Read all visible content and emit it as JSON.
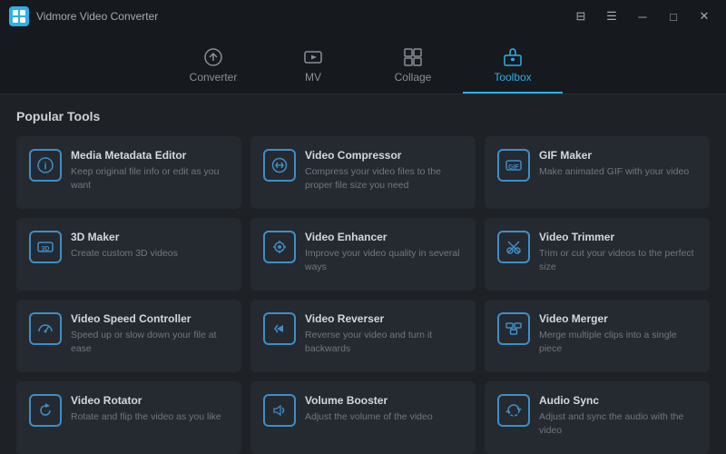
{
  "app": {
    "title": "Vidmore Video Converter"
  },
  "titlebar": {
    "controls": {
      "menu": "☰",
      "minimize": "─",
      "maximize": "□",
      "close": "✕",
      "subtitle": "⊟"
    }
  },
  "nav": {
    "tabs": [
      {
        "id": "converter",
        "label": "Converter",
        "active": false
      },
      {
        "id": "mv",
        "label": "MV",
        "active": false
      },
      {
        "id": "collage",
        "label": "Collage",
        "active": false
      },
      {
        "id": "toolbox",
        "label": "Toolbox",
        "active": true
      }
    ]
  },
  "main": {
    "section_title": "Popular Tools",
    "tools": [
      {
        "id": "media-metadata-editor",
        "name": "Media Metadata Editor",
        "desc": "Keep original file info or edit as you want",
        "icon_type": "info"
      },
      {
        "id": "video-compressor",
        "name": "Video Compressor",
        "desc": "Compress your video files to the proper file size you need",
        "icon_type": "compress"
      },
      {
        "id": "gif-maker",
        "name": "GIF Maker",
        "desc": "Make animated GIF with your video",
        "icon_type": "gif"
      },
      {
        "id": "3d-maker",
        "name": "3D Maker",
        "desc": "Create custom 3D videos",
        "icon_type": "3d"
      },
      {
        "id": "video-enhancer",
        "name": "Video Enhancer",
        "desc": "Improve your video quality in several ways",
        "icon_type": "enhancer"
      },
      {
        "id": "video-trimmer",
        "name": "Video Trimmer",
        "desc": "Trim or cut your videos to the perfect size",
        "icon_type": "trim"
      },
      {
        "id": "video-speed-controller",
        "name": "Video Speed Controller",
        "desc": "Speed up or slow down your file at ease",
        "icon_type": "speed"
      },
      {
        "id": "video-reverser",
        "name": "Video Reverser",
        "desc": "Reverse your video and turn it backwards",
        "icon_type": "reverse"
      },
      {
        "id": "video-merger",
        "name": "Video Merger",
        "desc": "Merge multiple clips into a single piece",
        "icon_type": "merge"
      },
      {
        "id": "video-rotator",
        "name": "Video Rotator",
        "desc": "Rotate and flip the video as you like",
        "icon_type": "rotate"
      },
      {
        "id": "volume-booster",
        "name": "Volume Booster",
        "desc": "Adjust the volume of the video",
        "icon_type": "volume"
      },
      {
        "id": "audio-sync",
        "name": "Audio Sync",
        "desc": "Adjust and sync the audio with the video",
        "icon_type": "sync"
      }
    ]
  },
  "colors": {
    "accent": "#2db0e8",
    "icon_border": "#3d8fc7",
    "card_bg": "#252930"
  }
}
